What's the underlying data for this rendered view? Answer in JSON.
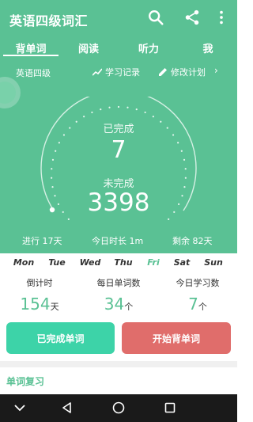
{
  "app": {
    "title": "英语四级词汇"
  },
  "tabs": [
    {
      "label": "背单词",
      "active": true
    },
    {
      "label": "阅读",
      "active": false
    },
    {
      "label": "听力",
      "active": false
    },
    {
      "label": "我",
      "active": false
    }
  ],
  "subrow": {
    "book": "英语四级",
    "record_label": "学习记录",
    "plan_label": "修改计划"
  },
  "progress": {
    "done_label": "已完成",
    "done_count": "7",
    "todo_label": "未完成",
    "todo_count": "3398"
  },
  "stats": {
    "progress_text": "进行 17天",
    "today_text": "今日时长 1m",
    "remaining_text": "剩余 82天"
  },
  "week": {
    "days": [
      "Mon",
      "Tue",
      "Wed",
      "Thu",
      "Fri",
      "Sat",
      "Sun"
    ],
    "today_index": 4
  },
  "info": [
    {
      "label": "倒计时",
      "value": "154",
      "unit": "天"
    },
    {
      "label": "每日单词数",
      "value": "34",
      "unit": "个"
    },
    {
      "label": "今日学习数",
      "value": "7",
      "unit": "个"
    }
  ],
  "buttons": {
    "done": "已完成单词",
    "start": "开始背单词"
  },
  "review": {
    "title": "单词复习"
  },
  "colors": {
    "primary": "#5ac194",
    "done_button": "#3dd3a8",
    "start_button": "#e06d6b",
    "navbar": "#1a1a1a"
  },
  "icons": {
    "search": "search-icon",
    "share": "share-icon",
    "more": "more-vert-icon",
    "record": "trend-icon",
    "plan": "pencil-icon",
    "arrow": "chevron-right-icon",
    "nav_collapse": "chevron-down-icon",
    "nav_back": "back-triangle-icon",
    "nav_home": "home-circle-icon",
    "nav_recents": "recents-square-icon"
  }
}
